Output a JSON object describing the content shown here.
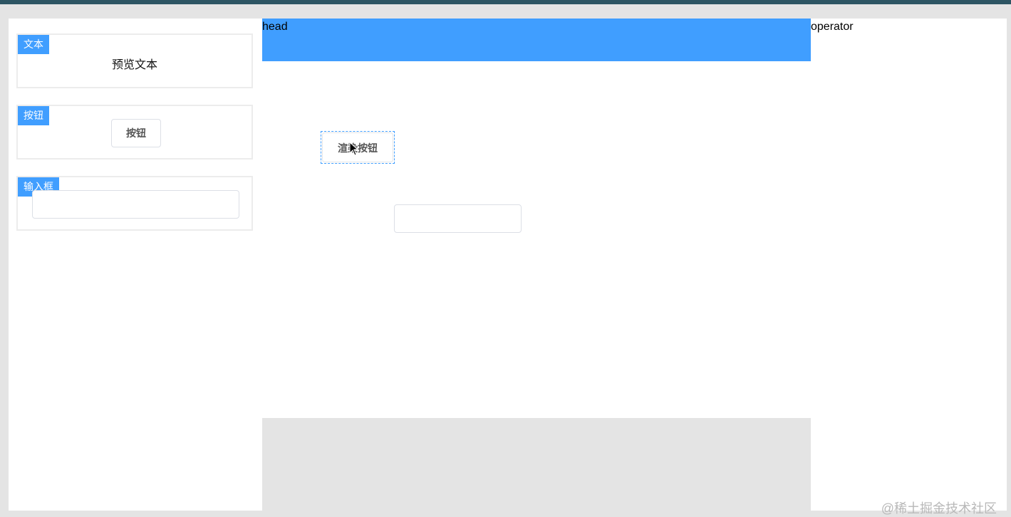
{
  "palette": {
    "items": [
      {
        "tag": "文本",
        "preview_text": "预览文本"
      },
      {
        "tag": "按钮",
        "preview_button": "按钮"
      },
      {
        "tag": "输入框",
        "preview_input": ""
      }
    ]
  },
  "canvas": {
    "head_label": "head",
    "rendered_button": "渲染按钮",
    "rendered_input": ""
  },
  "operator": {
    "label": "operator"
  },
  "watermark": "@稀土掘金技术社区",
  "colors": {
    "accent": "#409eff",
    "top_bar": "#2d5563",
    "page_bg": "#e4e4e4",
    "card_border": "#ececec"
  }
}
